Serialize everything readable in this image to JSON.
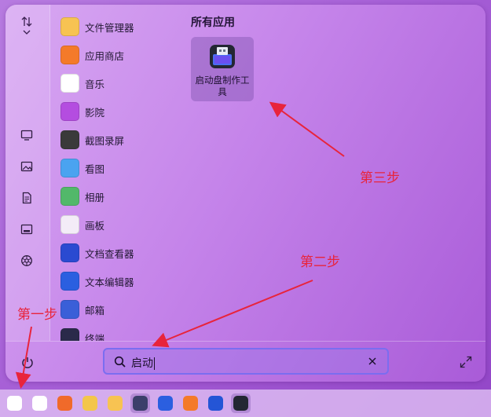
{
  "rail": {
    "sort_icon": "sort-arrows-icon",
    "categories": [
      "computer-icon",
      "image-icon",
      "document-icon",
      "media-icon",
      "settings-icon"
    ]
  },
  "app_list": [
    {
      "label": "文件管理器",
      "icon": "file-manager-icon",
      "color": "#f7c352"
    },
    {
      "label": "应用商店",
      "icon": "app-store-icon",
      "color": "#f47a2a"
    },
    {
      "label": "音乐",
      "icon": "music-icon",
      "color": "#ffffff"
    },
    {
      "label": "影院",
      "icon": "video-icon",
      "color": "#b44de0"
    },
    {
      "label": "截图录屏",
      "icon": "screenshot-icon",
      "color": "#3a3a3a"
    },
    {
      "label": "看图",
      "icon": "image-viewer-icon",
      "color": "#4aa3f0"
    },
    {
      "label": "相册",
      "icon": "album-icon",
      "color": "#52b86a"
    },
    {
      "label": "画板",
      "icon": "draw-icon",
      "color": "#f3ecf7"
    },
    {
      "label": "文档查看器",
      "icon": "document-viewer-icon",
      "color": "#2a4ad1"
    },
    {
      "label": "文本编辑器",
      "icon": "text-editor-icon",
      "color": "#2b5fe0"
    },
    {
      "label": "邮箱",
      "icon": "mail-icon",
      "color": "#3a5fd8"
    },
    {
      "label": "终端",
      "icon": "terminal-icon",
      "color": "#2a2a4a"
    }
  ],
  "section_title": "所有应用",
  "result_app": {
    "label": "启动盘制作工具",
    "icon": "usb-boot-maker-icon"
  },
  "search": {
    "value": "启动",
    "icon": "search-icon",
    "clear_icon": "close-icon"
  },
  "power_icon": "power-icon",
  "expand_icon": "expand-icon",
  "annotations": {
    "step1": "第一步",
    "step2": "第二步",
    "step3": "第三步"
  },
  "taskbar": [
    "launcher-icon",
    "search-app-icon",
    "multitask-icon",
    "toolbox-icon",
    "file-manager-icon",
    "terminal-icon",
    "text-editor-icon",
    "app-store-icon",
    "word-icon",
    "usb-boot-maker-icon"
  ]
}
